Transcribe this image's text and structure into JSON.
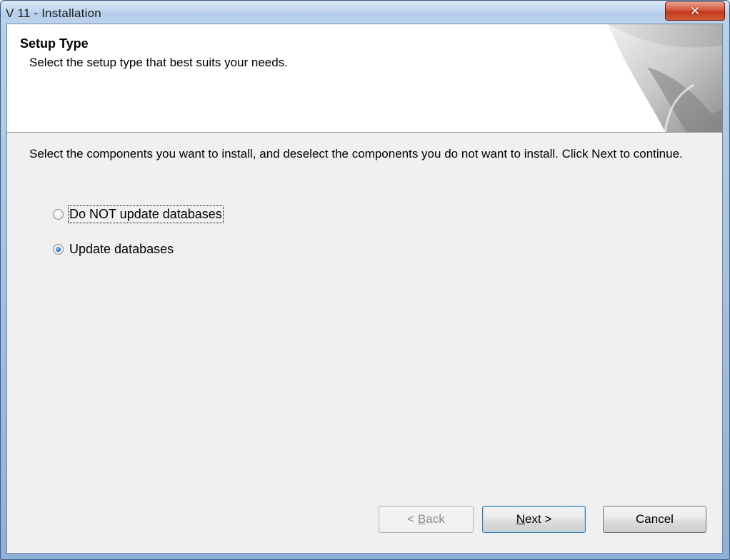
{
  "window": {
    "title": "V 11 - Installation",
    "close_icon": "close-icon"
  },
  "header": {
    "title": "Setup Type",
    "subtitle": "Select the setup type that best suits your needs."
  },
  "body": {
    "instructions": "Select the components you want to install, and deselect the components you do not want to install.  Click Next to continue."
  },
  "options": [
    {
      "label": "Do NOT update databases",
      "selected": false,
      "focused": true
    },
    {
      "label": "Update databases",
      "selected": true,
      "focused": false
    }
  ],
  "buttons": {
    "back": {
      "prefix": "< ",
      "mnemonic": "B",
      "rest": "ack",
      "enabled": false
    },
    "next": {
      "mnemonic": "N",
      "rest": "ext >",
      "enabled": true
    },
    "cancel": {
      "label": "Cancel",
      "enabled": true
    }
  },
  "colors": {
    "title_bar": "#c2d7ee",
    "close_button": "#c23a1e",
    "radio_selected": "#1f7fd0",
    "client_background": "#f0f0f0"
  }
}
